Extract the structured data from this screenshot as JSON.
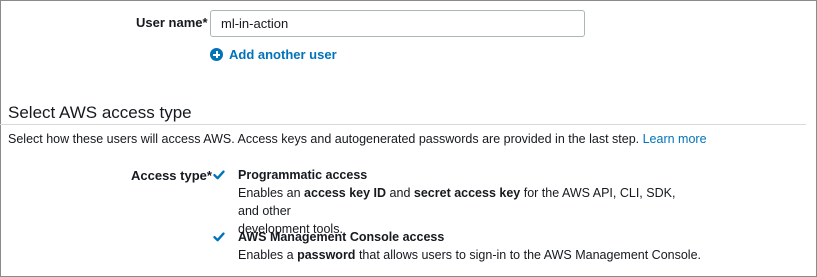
{
  "user_name": {
    "label": "User name*",
    "value": "ml-in-action"
  },
  "add_user": {
    "label": "Add another user",
    "icon": "plus-circle-icon"
  },
  "access_section": {
    "title": "Select AWS access type",
    "description": "Select how these users will access AWS. Access keys and autogenerated passwords are provided in the last step.",
    "learn_more": "Learn more"
  },
  "access_type": {
    "label": "Access type*",
    "options": [
      {
        "title": "Programmatic access",
        "checked": true,
        "desc_1": "Enables an",
        "desc_bold_1": "access key ID",
        "desc_2": "and",
        "desc_bold_2": "secret access key",
        "desc_3": "for the AWS API, CLI, SDK, and other",
        "desc_4": "development tools."
      },
      {
        "title": "AWS Management Console access",
        "checked": true,
        "desc_1": "Enables a",
        "desc_bold_1": "password",
        "desc_2": "that allows users to sign-in to the AWS Management Console."
      }
    ]
  },
  "colors": {
    "link": "#0073bb",
    "text": "#16191f",
    "border": "#aab7b8",
    "divider": "#d5dbdb"
  }
}
